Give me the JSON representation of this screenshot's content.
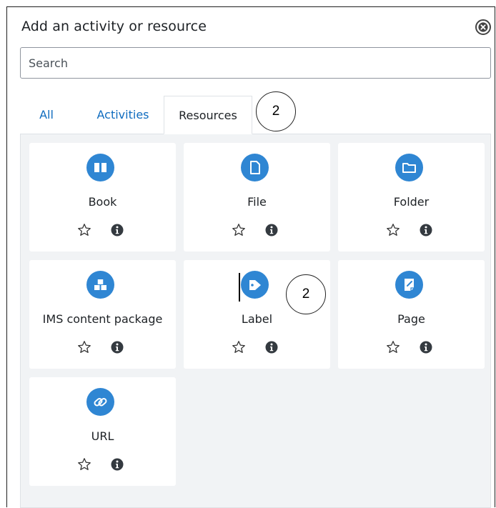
{
  "dialog": {
    "title": "Add an activity or resource",
    "close_icon": "close-circle-icon"
  },
  "search": {
    "placeholder": "Search"
  },
  "tabs": [
    {
      "label": "All",
      "active": false
    },
    {
      "label": "Activities",
      "active": false
    },
    {
      "label": "Resources",
      "active": true
    }
  ],
  "modules": [
    {
      "label": "Book",
      "icon": "book-icon"
    },
    {
      "label": "File",
      "icon": "file-icon"
    },
    {
      "label": "Folder",
      "icon": "folder-icon"
    },
    {
      "label": "IMS content package",
      "icon": "package-icon"
    },
    {
      "label": "Label",
      "icon": "tag-icon"
    },
    {
      "label": "Page",
      "icon": "page-icon"
    },
    {
      "label": "URL",
      "icon": "link-icon"
    }
  ],
  "callouts": [
    {
      "text": "2"
    },
    {
      "text": "2"
    }
  ],
  "colors": {
    "accent": "#0f6cbf",
    "icon_bg": "#2f86d3",
    "panel_bg": "#f1f3f5"
  }
}
